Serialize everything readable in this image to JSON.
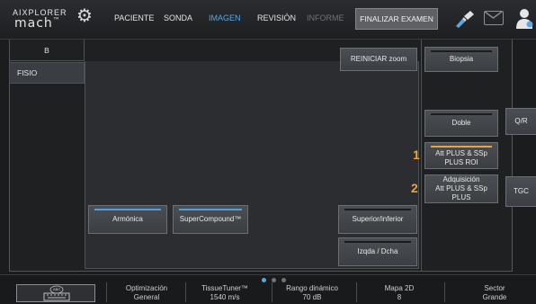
{
  "brand": {
    "line1": "AIXPLORER",
    "line2": "mach",
    "suffix": "™"
  },
  "menu": {
    "paciente": "PACIENTE",
    "sonda": "SONDA",
    "imagen": "IMAGEN",
    "revision": "REVISIÓN",
    "informe": "INFORME",
    "finalizar": "FINALIZAR EXAMEN"
  },
  "tabs": {
    "b": "B",
    "fisio": "FISIO"
  },
  "content": {
    "reiniciar_zoom": "REINICIAR zoom",
    "armonica": "Armónica",
    "supercompound": "SuperCompound™",
    "superior_inferior": "Superior/inferior",
    "izqda_dcha": "Izqda / Dcha"
  },
  "right_panel": {
    "biopsia": "Biopsia",
    "doble": "Doble",
    "att_plus": "Att PLUS & SSp PLUS ROI",
    "adquisicion_line1": "Adquisición",
    "adquisicion_line2": "Att PLUS & SSp PLUS",
    "badge1": "1",
    "badge2": "2"
  },
  "side": {
    "qr": "Q/R",
    "tgc": "TGC"
  },
  "keyboard_label": "ABC",
  "bottom": {
    "optimizacion": {
      "label": "Optimización",
      "value": "General"
    },
    "tissuetuner": {
      "label": "TissueTuner™",
      "value": "1540 m/s"
    },
    "rango": {
      "label": "Rango dinámico",
      "value": "70 dB"
    },
    "mapa": {
      "label": "Mapa 2D",
      "value": "8"
    },
    "sector": {
      "label": "Sector",
      "value": "Grande"
    }
  },
  "colors": {
    "accent_blue": "#5aa7e8",
    "badge_orange": "#f0a23c",
    "finalizar_bg": "#5e6064"
  },
  "icons": [
    "gear-icon",
    "probe-icon",
    "mail-icon",
    "user-icon",
    "keyboard-icon"
  ]
}
